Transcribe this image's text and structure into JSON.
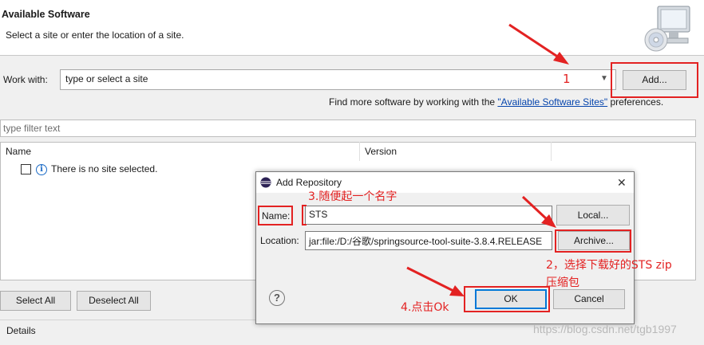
{
  "header": {
    "title": "Available Software",
    "subtitle": "Select a site or enter the location of a site."
  },
  "work_with": {
    "label": "Work with:",
    "placeholder": "type or select a site",
    "add_button": "Add...",
    "find_more_prefix": "Find more software by working with the ",
    "find_more_link": "\"Available Software Sites\"",
    "find_more_suffix": " preferences."
  },
  "filter": {
    "placeholder": "type filter text"
  },
  "tree": {
    "columns": [
      "Name",
      "Version"
    ],
    "empty_message": "There is no site selected."
  },
  "buttons": {
    "select_all": "Select All",
    "deselect_all": "Deselect All"
  },
  "details": {
    "label": "Details"
  },
  "dialog": {
    "title": "Add Repository",
    "name_label": "Name:",
    "name_value": "STS",
    "location_label": "Location:",
    "location_value": "jar:file:/D:/谷歌/springsource-tool-suite-3.8.4.RELEASE",
    "local_button": "Local...",
    "archive_button": "Archive...",
    "ok_button": "OK",
    "cancel_button": "Cancel",
    "close_glyph": "✕",
    "help_glyph": "?"
  },
  "annotations": {
    "step1": "1",
    "step2_line1": "2，选择下载好的STS zip",
    "step2_line2": "压缩包",
    "step3": "3.随便起一个名字",
    "step4": "4.点击Ok",
    "color": "#e32222"
  },
  "watermark": "https://blog.csdn.net/tgb1997"
}
